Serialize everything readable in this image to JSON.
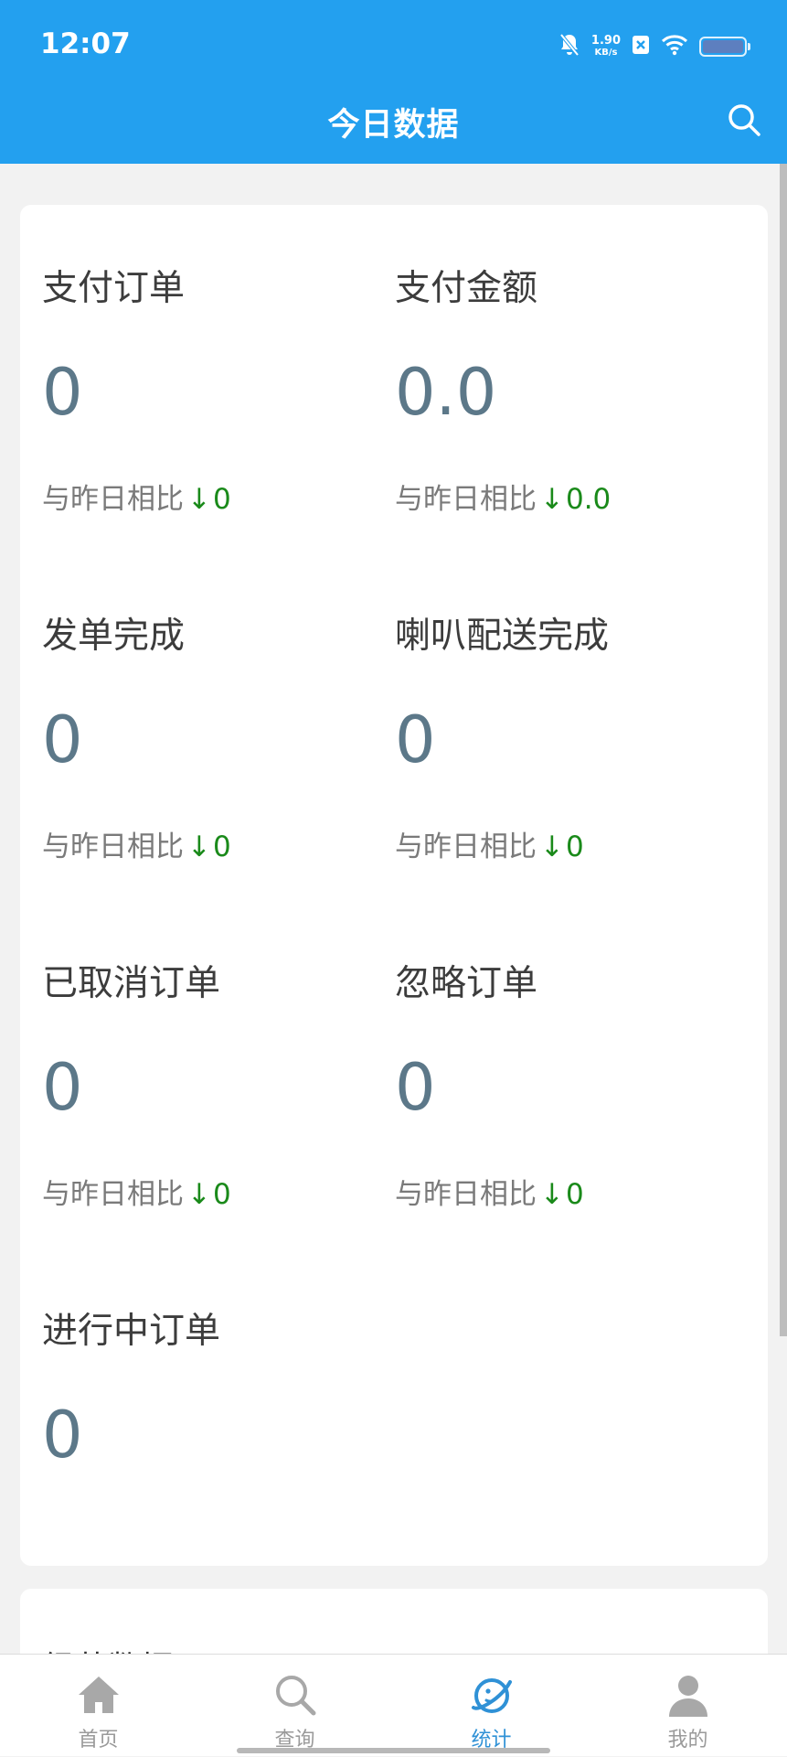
{
  "status_bar": {
    "time": "12:07",
    "net_speed_value": "1.90",
    "net_speed_unit": "KB/s",
    "icons": [
      "bell-muted-icon",
      "sim-x-icon",
      "wifi-icon",
      "battery-icon"
    ]
  },
  "header": {
    "title": "今日数据",
    "search_icon": "search-icon"
  },
  "stats": [
    {
      "label": "支付订单",
      "value": "0",
      "compare_label": "与昨日相比",
      "arrow": "↓",
      "change": "0"
    },
    {
      "label": "支付金额",
      "value": "0.0",
      "compare_label": "与昨日相比",
      "arrow": "↓",
      "change": "0.0"
    },
    {
      "label": "发单完成",
      "value": "0",
      "compare_label": "与昨日相比",
      "arrow": "↓",
      "change": "0"
    },
    {
      "label": "喇叭配送完成",
      "value": "0",
      "compare_label": "与昨日相比",
      "arrow": "↓",
      "change": "0"
    },
    {
      "label": "已取消订单",
      "value": "0",
      "compare_label": "与昨日相比",
      "arrow": "↓",
      "change": "0"
    },
    {
      "label": "忽略订单",
      "value": "0",
      "compare_label": "与昨日相比",
      "arrow": "↓",
      "change": "0"
    },
    {
      "label": "进行中订单",
      "value": "0"
    }
  ],
  "more_card": {
    "title": "经营数据",
    "arrow": "›"
  },
  "tabs": [
    {
      "label": "首页",
      "icon": "home-icon",
      "active": false
    },
    {
      "label": "查询",
      "icon": "search-icon",
      "active": false
    },
    {
      "label": "统计",
      "icon": "planet-icon",
      "active": true
    },
    {
      "label": "我的",
      "icon": "person-icon",
      "active": false
    }
  ],
  "colors": {
    "primary": "#23a0ef",
    "value_text": "#5c7889",
    "decrease": "#1a8a1a",
    "tab_active": "#2f91d6",
    "tab_inactive": "#9a9a9a"
  }
}
